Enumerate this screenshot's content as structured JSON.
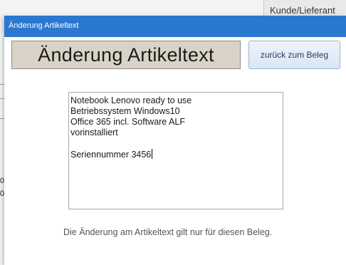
{
  "background": {
    "top_right_label": "Kunde/Lieferant",
    "left_fragments": [
      "0",
      "0"
    ]
  },
  "dialog": {
    "title": "Änderung Artikeltext",
    "heading": "Änderung Artikeltext",
    "back_button_label": "zurück zum Beleg",
    "article_text_lines": [
      "Notebook Lenovo ready to use",
      "Betriebssystem Windows10",
      "Office 365 incl. Software ALF",
      "vorinstalliert",
      "",
      "Seriennummer  3456"
    ],
    "note": "Die Änderung am Artikeltext gilt nur für diesen Beleg."
  },
  "colors": {
    "titlebar": "#2b78d0",
    "heading_bg": "#d8d3c6",
    "button_bg": "#dfe9f5"
  }
}
